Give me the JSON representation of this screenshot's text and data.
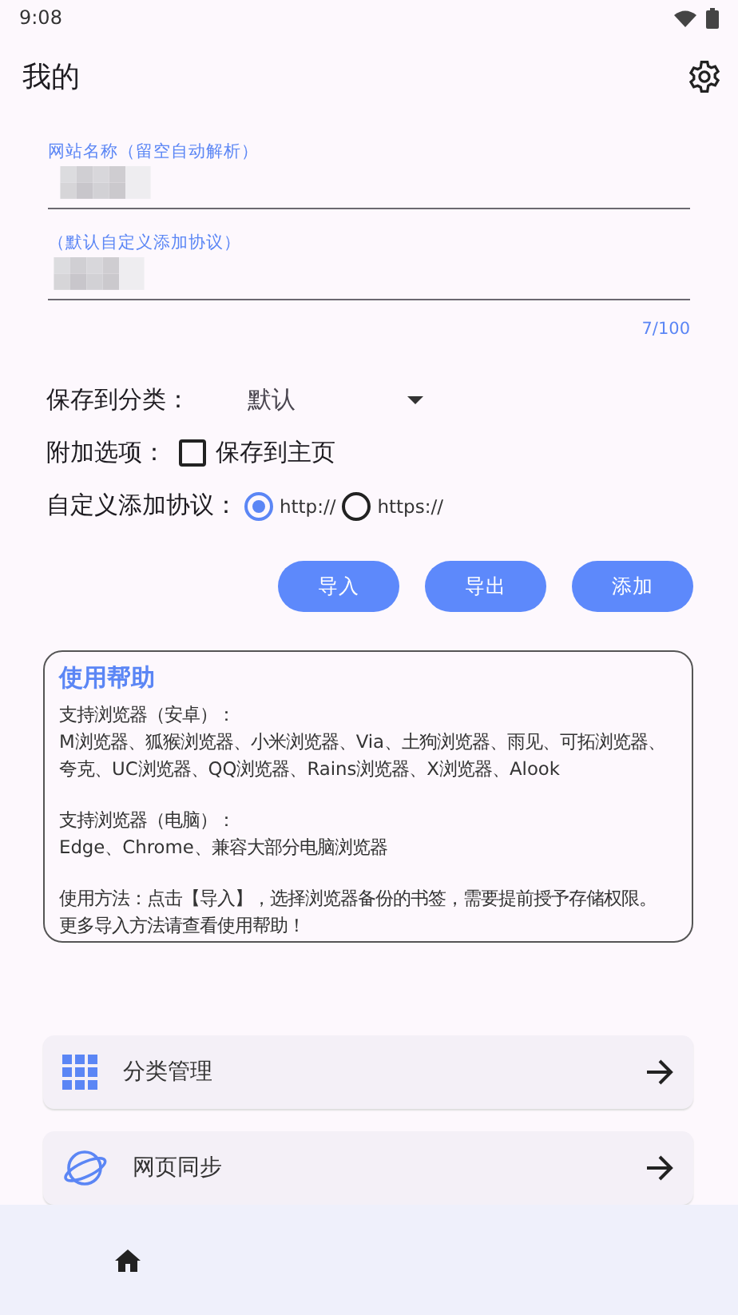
{
  "status_bar": {
    "time": "9:08"
  },
  "app_bar": {
    "title": "我的"
  },
  "fields": [
    {
      "label": "网站名称（留空自动解析）"
    },
    {
      "label": "（默认自定义添加协议）"
    }
  ],
  "counter": "7/100",
  "category": {
    "label": "保存到分类：",
    "value": "默认"
  },
  "extra": {
    "label": "附加选项：",
    "checkbox": {
      "label": "保存到主页",
      "checked": false
    }
  },
  "protocol": {
    "label": "自定义添加协议：",
    "options": [
      {
        "label": "http://",
        "selected": true
      },
      {
        "label": "https://",
        "selected": false
      }
    ]
  },
  "buttons": [
    "导入",
    "导出",
    "添加"
  ],
  "help": {
    "title": "使用帮助",
    "blocks": [
      [
        "支持浏览器（安卓）：",
        "M浏览器、狐猴浏览器、小米浏览器、Via、土狗浏览器、雨见、可拓浏览器、夸克、UC浏览器、QQ浏览器、Rains浏览器、X浏览器、Alook"
      ],
      [
        "支持浏览器（电脑）：",
        "Edge、Chrome、兼容大部分电脑浏览器"
      ],
      [
        "使用方法：点击【导入】，选择浏览器备份的书签，需要提前授予存储权限。",
        "更多导入方法请查看使用帮助！"
      ]
    ]
  },
  "menu": [
    {
      "label": "分类管理",
      "kind": "grid"
    },
    {
      "label": "网页同步",
      "kind": "planet"
    }
  ],
  "nav": [
    {
      "kind": "home"
    }
  ]
}
